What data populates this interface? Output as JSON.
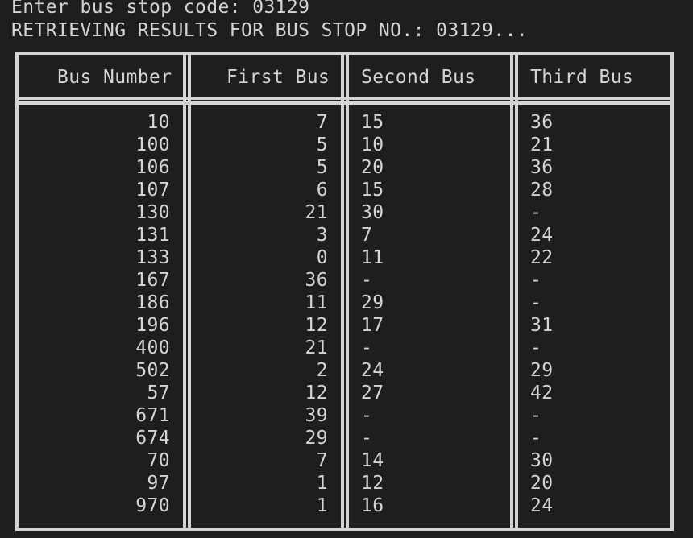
{
  "terminal": {
    "prompt_line": "Enter bus stop code: 03129",
    "status_line": "RETRIEVING RESULTS FOR BUS STOP NO.: 03129..."
  },
  "table": {
    "headers": [
      "Bus Number",
      "First Bus",
      "Second Bus",
      "Third Bus"
    ],
    "rows": [
      [
        "10",
        "7",
        "15",
        "36"
      ],
      [
        "100",
        "5",
        "10",
        "21"
      ],
      [
        "106",
        "5",
        "20",
        "36"
      ],
      [
        "107",
        "6",
        "15",
        "28"
      ],
      [
        "130",
        "21",
        "30",
        "-"
      ],
      [
        "131",
        "3",
        "7",
        "24"
      ],
      [
        "133",
        "0",
        "11",
        "22"
      ],
      [
        "167",
        "36",
        "-",
        "-"
      ],
      [
        "186",
        "11",
        "29",
        "-"
      ],
      [
        "196",
        "12",
        "17",
        "31"
      ],
      [
        "400",
        "21",
        "-",
        "-"
      ],
      [
        "502",
        "2",
        "24",
        "29"
      ],
      [
        "57",
        "12",
        "27",
        "42"
      ],
      [
        "671",
        "39",
        "-",
        "-"
      ],
      [
        "674",
        "29",
        "-",
        "-"
      ],
      [
        "70",
        "7",
        "14",
        "30"
      ],
      [
        "97",
        "1",
        "12",
        "20"
      ],
      [
        "970",
        "1",
        "16",
        "24"
      ]
    ]
  }
}
